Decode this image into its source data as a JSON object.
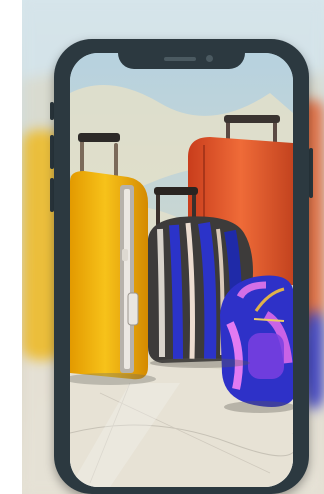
{
  "image": {
    "subject": "travel-luggage-on-map",
    "colors": {
      "phone_frame": "#2c3940",
      "yellow_suitcase": "#f2b705",
      "orange_suitcase": "#e0552a",
      "striped_bag": "#2a2fb8",
      "blue_backpack": "#2d2fc9",
      "map_water": "#b9d3df",
      "map_land": "#e6dfc9"
    },
    "icons": [
      "phone-speaker-icon",
      "phone-camera-icon"
    ]
  }
}
